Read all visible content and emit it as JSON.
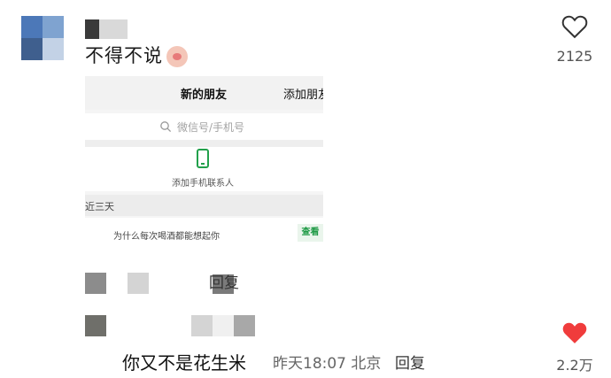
{
  "top_comment": {
    "text": "不得不说",
    "like_count": "2125"
  },
  "shot": {
    "title": "新的朋友",
    "add_friend": "添加朋友",
    "search_placeholder": "微信号/手机号",
    "add_phone_label": "添加手机联系人",
    "section_label": "近三天",
    "request_message": "为什么每次喝酒都能想起你",
    "view_button": "查看"
  },
  "reply_label_1": "回复",
  "bottom_comment": {
    "text": "你又不是花生米",
    "meta": "昨天18:07 北京",
    "reply": "回复",
    "like_count": "2.2万"
  },
  "colors": {
    "heart_filled": "#f03c3c",
    "view_green": "#1f9a46"
  },
  "icons": [
    "heart-outline-icon",
    "heart-filled-icon",
    "search-icon",
    "phone-icon"
  ]
}
